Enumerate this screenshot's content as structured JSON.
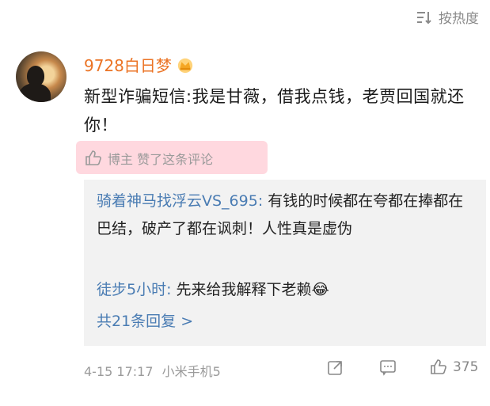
{
  "sort": {
    "label": "按热度",
    "icon": "sort-icon"
  },
  "comment": {
    "username": "9728白日梦",
    "badge_icon": "crown-icon",
    "text": "新型诈骗短信:我是甘薇，借我点钱，老贾回国就还你！",
    "liked_by_author": "博主 赞了这条评论"
  },
  "replies": {
    "items": [
      {
        "name": "骑着神马找浮云VS_695",
        "text": "有钱的时候都在夸都在捧都在巴结，破产了都在讽刺！人性真是虚伪"
      },
      {
        "name": "徒步5小时",
        "text": "先来给我解释下老赖",
        "emoji": "😂"
      }
    ],
    "more_label": "共21条回复 >"
  },
  "footer": {
    "timestamp": "4-15 17:17",
    "device": "小米手机5",
    "like_count": "375"
  },
  "colors": {
    "username": "#eb7324",
    "link": "#4a7cb3",
    "highlight": "#ffd8df"
  }
}
